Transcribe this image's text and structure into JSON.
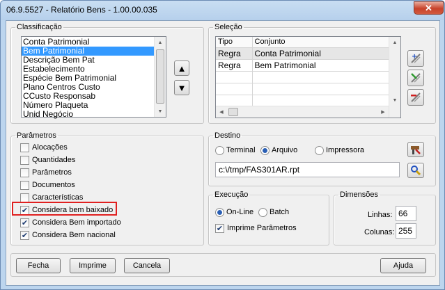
{
  "window": {
    "title": "06.9.5527 - Relatório Bens - 1.00.00.035",
    "close_glyph": "✕"
  },
  "classificacao": {
    "legend": "Classificação",
    "items": [
      {
        "label": "Conta Patrimonial",
        "selected": false
      },
      {
        "label": "Bem Patrimonial",
        "selected": true
      },
      {
        "label": "Descrição Bem Pat",
        "selected": false
      },
      {
        "label": "Estabelecimento",
        "selected": false
      },
      {
        "label": "Espécie Bem Patrimonial",
        "selected": false
      },
      {
        "label": "Plano Centros Custo",
        "selected": false
      },
      {
        "label": "CCusto Responsab",
        "selected": false
      },
      {
        "label": "Número Plaqueta",
        "selected": false
      },
      {
        "label": "Unid Negócio",
        "selected": false
      }
    ],
    "move_up_icon": "triangle-up",
    "move_down_icon": "triangle-down",
    "up_glyph": "▲",
    "down_glyph": "▼"
  },
  "selecao": {
    "legend": "Seleção",
    "columns": [
      "Tipo",
      "Conjunto"
    ],
    "rows": [
      {
        "tipo": "Regra",
        "conjunto": "Conta Patrimonial"
      },
      {
        "tipo": "Regra",
        "conjunto": "Bem Patrimonial"
      }
    ],
    "tools": [
      "add-rule-icon",
      "edit-rule-icon",
      "remove-rule-icon"
    ]
  },
  "parametros": {
    "legend": "Parâmetros",
    "options": [
      {
        "label": "Alocações",
        "checked": false
      },
      {
        "label": "Quantidades",
        "checked": false
      },
      {
        "label": "Parâmetros",
        "checked": false
      },
      {
        "label": "Documentos",
        "checked": false
      },
      {
        "label": "Características",
        "checked": false
      },
      {
        "label": "Considera bem baixado",
        "checked": true,
        "highlighted": true
      },
      {
        "label": "Considera Bem importado",
        "checked": true
      },
      {
        "label": "Considera Bem nacional",
        "checked": true
      }
    ]
  },
  "destino": {
    "legend": "Destino",
    "options": [
      {
        "label": "Terminal",
        "selected": false
      },
      {
        "label": "Arquivo",
        "selected": true
      },
      {
        "label": "Impressora",
        "selected": false
      }
    ],
    "file_path": "c:\\/tmp/FAS301AR.rpt",
    "config_icon": "printer-config-icon",
    "file_icon": "file-search-icon"
  },
  "execucao": {
    "legend": "Execução",
    "options": [
      {
        "label": "On-Line",
        "selected": true
      },
      {
        "label": "Batch",
        "selected": false
      }
    ],
    "print_params_label": "Imprime Parâmetros",
    "print_params_checked": true
  },
  "dimensoes": {
    "legend": "Dimensões",
    "linhas_label": "Linhas:",
    "linhas_value": "66",
    "colunas_label": "Colunas:",
    "colunas_value": "255"
  },
  "buttons": {
    "fecha": "Fecha",
    "imprime": "Imprime",
    "cancela": "Cancela",
    "ajuda": "Ajuda"
  },
  "colors": {
    "selection": "#3399ff",
    "highlight_border": "#e02020",
    "window_frame": "#bcd5ee"
  }
}
